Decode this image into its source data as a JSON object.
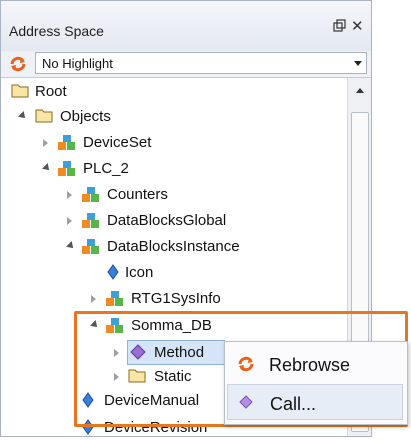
{
  "panel": {
    "title": "Address Space"
  },
  "toolbar": {
    "highlight_select": "No Highlight"
  },
  "tree": {
    "root": "Root",
    "objects": "Objects",
    "deviceset": "DeviceSet",
    "plc2": "PLC_2",
    "counters": "Counters",
    "datablocksglobal": "DataBlocksGlobal",
    "datablocksinstance": "DataBlocksInstance",
    "icon": "Icon",
    "rtg1sysinfo": "RTG1SysInfo",
    "somma_db": "Somma_DB",
    "method": "Method",
    "static": "Static",
    "devicemanual": "DeviceManual",
    "devicerevision": "DeviceRevision"
  },
  "context_menu": {
    "rebrowse": "Rebrowse",
    "call": "Call..."
  },
  "colors": {
    "highlight_orange": "#e8761e",
    "selection_blue": "#d5e5f7"
  }
}
